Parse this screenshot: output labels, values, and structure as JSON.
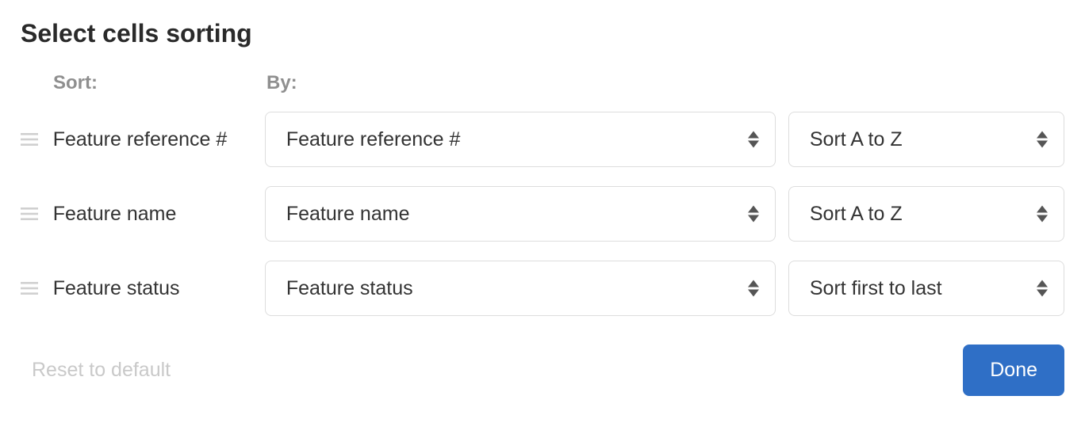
{
  "title": "Select cells sorting",
  "headers": {
    "sort": "Sort:",
    "by": "By:"
  },
  "rows": [
    {
      "label": "Feature reference #",
      "field": "Feature reference #",
      "order": "Sort A to Z"
    },
    {
      "label": "Feature name",
      "field": "Feature name",
      "order": "Sort A to Z"
    },
    {
      "label": "Feature status",
      "field": "Feature status",
      "order": "Sort first to last"
    }
  ],
  "footer": {
    "reset": "Reset to default",
    "done": "Done"
  }
}
